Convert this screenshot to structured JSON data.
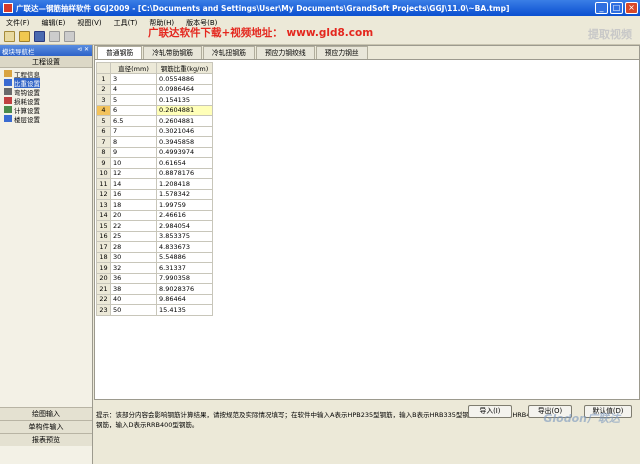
{
  "window": {
    "title": "广联达—钢筋抽样软件 GGJ2009 - [C:\\Documents and Settings\\User\\My Documents\\GrandSoft Projects\\GGJ\\11.0\\~BA.tmp]"
  },
  "banner": "广联达软件下载+视频地址： www.gld8.com",
  "watermark": "提取视频",
  "menu": [
    "文件(F)",
    "编辑(E)",
    "视图(V)",
    "工具(T)",
    "帮助(H)",
    "版本号(B)"
  ],
  "sidebar": {
    "title": "模块导航栏",
    "pin": "⊲ ✕",
    "section": "工程设置",
    "items": [
      {
        "label": "工程信息",
        "icon": "doc-icon",
        "color": "#d9a441"
      },
      {
        "label": "比重设置",
        "icon": "weight-icon",
        "color": "#3a6bd1"
      },
      {
        "label": "弯钩设置",
        "icon": "hook-icon",
        "color": "#6a6a6a"
      },
      {
        "label": "损耗设置",
        "icon": "loss-icon",
        "color": "#c04040"
      },
      {
        "label": "计算设置",
        "icon": "calc-icon",
        "color": "#4a8a4a"
      },
      {
        "label": "楼层设置",
        "icon": "floor-icon",
        "color": "#3a6bd1"
      }
    ],
    "bottom": [
      "绘图输入",
      "单构件输入",
      "报表预览"
    ]
  },
  "tabs": [
    "普通钢筋",
    "冷轧带肋钢筋",
    "冷轧扭钢筋",
    "预应力钢绞线",
    "预应力钢丝"
  ],
  "table": {
    "headers": [
      "直径(mm)",
      "钢筋比重(kg/m)"
    ],
    "rows": [
      {
        "n": "1",
        "d": "3",
        "w": "0.0554886"
      },
      {
        "n": "2",
        "d": "4",
        "w": "0.0986464"
      },
      {
        "n": "3",
        "d": "5",
        "w": "0.154135"
      },
      {
        "n": "4",
        "d": "6",
        "w": "0.2604881"
      },
      {
        "n": "5",
        "d": "6.5",
        "w": "0.2604881"
      },
      {
        "n": "6",
        "d": "7",
        "w": "0.3021046"
      },
      {
        "n": "7",
        "d": "8",
        "w": "0.3945858"
      },
      {
        "n": "8",
        "d": "9",
        "w": "0.4993974"
      },
      {
        "n": "9",
        "d": "10",
        "w": "0.61654"
      },
      {
        "n": "10",
        "d": "12",
        "w": "0.8878176"
      },
      {
        "n": "11",
        "d": "14",
        "w": "1.208418"
      },
      {
        "n": "12",
        "d": "16",
        "w": "1.578342"
      },
      {
        "n": "13",
        "d": "18",
        "w": "1.99759"
      },
      {
        "n": "14",
        "d": "20",
        "w": "2.46616"
      },
      {
        "n": "15",
        "d": "22",
        "w": "2.984054"
      },
      {
        "n": "16",
        "d": "25",
        "w": "3.853375"
      },
      {
        "n": "17",
        "d": "28",
        "w": "4.833673"
      },
      {
        "n": "18",
        "d": "30",
        "w": "5.54886"
      },
      {
        "n": "19",
        "d": "32",
        "w": "6.31337"
      },
      {
        "n": "20",
        "d": "36",
        "w": "7.990358"
      },
      {
        "n": "21",
        "d": "38",
        "w": "8.9028376"
      },
      {
        "n": "22",
        "d": "40",
        "w": "9.86464"
      },
      {
        "n": "23",
        "d": "50",
        "w": "15.4135"
      }
    ]
  },
  "hint": "提示：该部分内容会影响钢筋计算结果，请按规范及实际情况填写；在软件中输入A表示HPB235型钢筋，输入B表示HRB335型钢筋，输入C表示HRB400型钢筋，输入D表示RRB400型钢筋。",
  "buttons": {
    "import": "导入(I)",
    "export": "导出(O)",
    "default": "默认值(D)"
  },
  "glodon": "Glodon广联达",
  "colors": {
    "titlebar": "#0a4fd0",
    "highlight": "#ffffb8",
    "banner": "#e4271e"
  }
}
